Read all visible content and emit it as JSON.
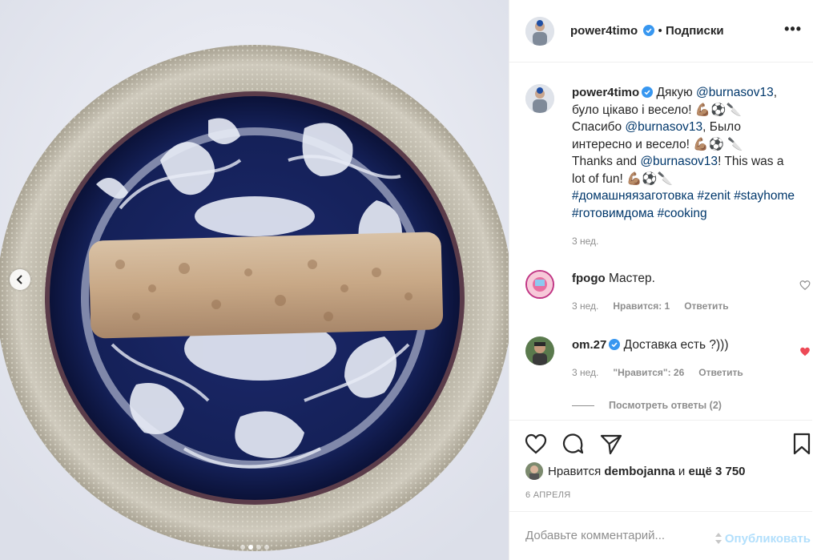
{
  "post": {
    "carousel_dots": 4,
    "active_dot": 1
  },
  "header": {
    "username": "power4timo",
    "separator": "•",
    "follow_label": "Подписки",
    "more_label": "•••",
    "verified": true
  },
  "caption": {
    "username": "power4timo",
    "parts": [
      {
        "t": "Дякую "
      },
      {
        "t": "@burnasov13",
        "link": true
      },
      {
        "t": ", було цікаво і весело! 💪🏽⚽🔪"
      },
      {
        "br": true
      },
      {
        "t": "Спасибо "
      },
      {
        "t": "@burnasov13",
        "link": true
      },
      {
        "t": ", Было интересно и весело! 💪🏽⚽ 🔪"
      },
      {
        "br": true
      },
      {
        "t": "Thanks and "
      },
      {
        "t": "@burnasov13",
        "link": true
      },
      {
        "t": "! This was a lot of fun! 💪🏽⚽🔪"
      },
      {
        "br": true
      },
      {
        "t": "#домашняязаготовка",
        "link": true
      },
      {
        "t": " "
      },
      {
        "t": "#zenit",
        "link": true
      },
      {
        "t": " "
      },
      {
        "t": "#stayhome",
        "link": true
      },
      {
        "t": " "
      },
      {
        "t": "#готовимдома",
        "link": true
      },
      {
        "t": " "
      },
      {
        "t": "#cooking",
        "link": true
      }
    ],
    "time": "3 нед."
  },
  "comments": [
    {
      "username": "fpogo",
      "text": "Мастер.",
      "time": "3 нед.",
      "likes_label": "Нравится: 1",
      "reply_label": "Ответить",
      "liked": false,
      "verified": false
    },
    {
      "username": "om.27",
      "text": "Доставка есть ?)))",
      "time": "3 нед.",
      "likes_label": "\"Нравится\": 26",
      "reply_label": "Ответить",
      "liked": true,
      "verified": true
    }
  ],
  "view_replies_label": "Посмотреть ответы (2)",
  "likes": {
    "prefix": "Нравится",
    "user": "dembojanna",
    "middle": "и",
    "rest": "ещё 3 750"
  },
  "date": "6 АПРЕЛЯ",
  "add_comment": {
    "placeholder": "Добавьте комментарий...",
    "publish_label": "Опубликовать"
  },
  "colors": {
    "link": "#00376b",
    "verified": "#3897f0",
    "liked_heart": "#ed4956",
    "publish_disabled": "#b2dffc"
  },
  "icons": [
    "chevron-left-icon",
    "heart-icon",
    "comment-icon",
    "share-icon",
    "bookmark-icon",
    "more-icon",
    "verified-badge-icon"
  ]
}
